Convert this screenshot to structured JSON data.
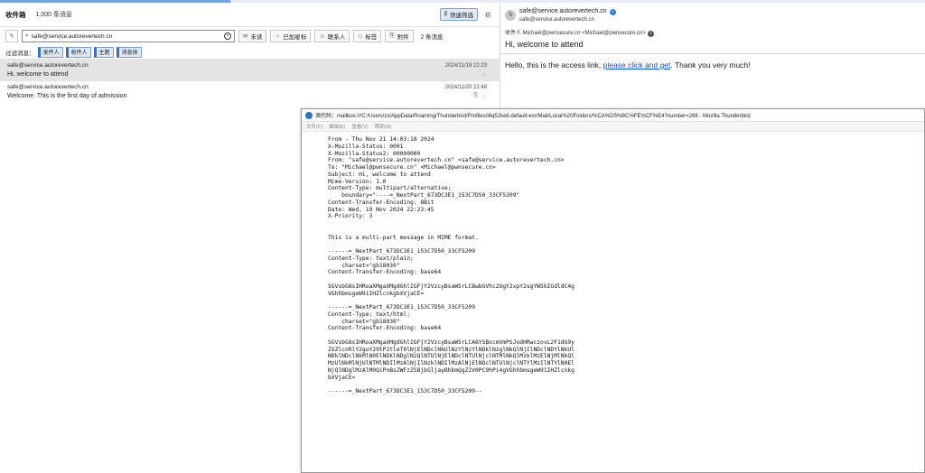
{
  "folder": {
    "name": "收件箱",
    "count": "1,000 条消息"
  },
  "toolbar": {
    "quick_filter_label": "快速筛选",
    "more_label": "祢"
  },
  "search": {
    "value": "safe@service.autorevertech.cn",
    "buttons": [
      {
        "icon": "unread-icon",
        "label": "未读"
      },
      {
        "icon": "star-icon",
        "label": "已加星标"
      },
      {
        "icon": "contact-icon",
        "label": "联系人"
      },
      {
        "icon": "tag-icon",
        "label": "标签"
      },
      {
        "icon": "attachment-icon",
        "label": "附件"
      }
    ],
    "match_count": "2 条消息"
  },
  "filter": {
    "label": "过滤消息：",
    "chips": [
      "发件人",
      "收件人",
      "主题",
      "消息体"
    ]
  },
  "messages": [
    {
      "sender": "safe@service.autorevertech.cn",
      "subject": "Hi, welcome to attend",
      "date": "2024/11/19 22:23",
      "selected": true
    },
    {
      "sender": "safe@service.autorevertech.cn",
      "subject": "Welcome. This is the first day of admission",
      "date": "2024/11/20 22:48",
      "selected": false
    }
  ],
  "header": {
    "avatar_letter": "S",
    "from_line1": "safe@service.autorevertech.cn",
    "from_line2": "safe@service.autorevertech.cn",
    "to": "收件人  Michael@pwnsecure.cn <Michael@pwnsecure.cn>",
    "subject": "Hi, welcome to attend"
  },
  "body": {
    "before": "Hello, this is the access link, ",
    "link": "please click and get",
    "after": ". Thank you very much!"
  },
  "source": {
    "title": "源代码：mailbox:///C:/Users/zx/AppData/Roaming/Thunderbird/Profiles/i6q52ke6.default-esr/Mail/Local%20Folders/%CA%D5%BC%FE%CF%E4?number=288 - Mozilla Thunderbird",
    "menu": [
      "文件(F)",
      "编辑(E)",
      "查看(V)",
      "帮助(H)"
    ],
    "text": "From - Thu Nov 21 14:03:18 2024\nX-Mozilla-Status: 0001\nX-Mozilla-Status2: 00000000\nFrom: \"safe@service.autorevertech.cn\" <safe@service.autorevertech.cn>\nTo: \"Michael@pwnsecure.cn\" <Michael@pwnsecure.cn>\nSubject: Hi, welcome to attend\nMime-Version: 1.0\nContent-Type: multipart/alternative;\n    boundary=\"----=_NextPart_673DC3E1_153C7D50_33CF5209\"\nContent-Transfer-Encoding: 8Bit\nDate: Wed, 19 Nov 2024 22:23:45\nX-Priority: 3\n\n\nThis is a multi-part message in MIME format.\n\n------=_NextPart_673DC3E1_153C7D50_33CF5209\nContent-Type: text/plain;\n    charset=\"gb18030\"\nContent-Transfer-Encoding: base64\n\nSGVsbG8sIHRoaXMgaXMgdGhlIGFjY2VzcyBsaW5rLCBwbGVhc2UgY2xpY2sgYW5kIGdldC4g\nVGhhbmsgeW91IHZlcnkgbXVjaCE=\n\n------=_NextPart_673DC3E1_153C7D50_33CF5209\nContent-Type: text/html;\n    charset=\"gb18030\"\nContent-Transfer-Encoding: base64\n\nSGVsbG8sIHRoaXMgaXMgdGhlIGFjY2VzcyBsaW5rLCA8YSBocmVmPSJodHRwczovL2F1dG9y\nZXZlcnRlY2guY29tP2tleT0lNjElNDclNkUlNzYlNzYlNDklNzglNkQlNjIlNDclNDYlNkUl\nNDklNDclNkMlN0ElNDklNDglNzQlNTUlNjElNDclNTUlNjclNTMlNkQlMzklMzElNjMlNkQl\nMzUlNkMlNjUlNTMlNDIlMzAlNjIlNzklNDIlMzAlNjElNDclNTUlNjclNTYlMzIlNTYlN0El\nNjQlNDglMzAlM0QiPnBsZWFzZSBjbGljayBhbmQgZ2V0PC9hPi4gVGhhbmsgeW91IHZlcnkg\nbXVjaCE=\n\n------=_NextPart_673DC3E1_153C7D50_33CF5209--"
  }
}
